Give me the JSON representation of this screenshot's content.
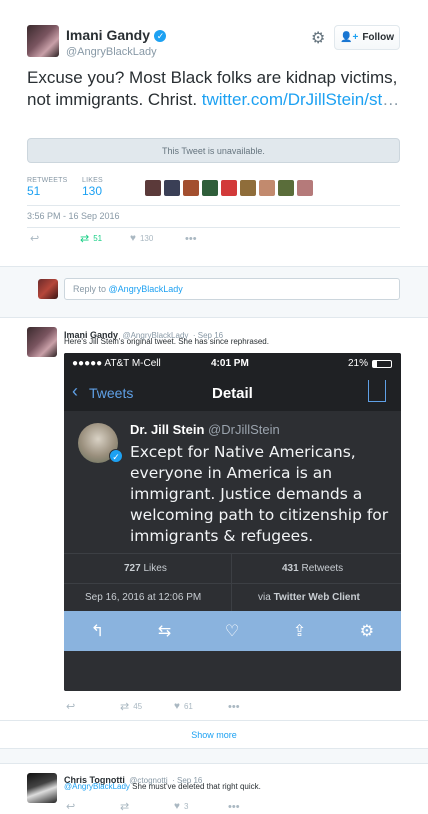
{
  "main_tweet": {
    "name": "Imani Gandy",
    "handle": "@AngryBlackLady",
    "follow_label": "Follow",
    "text": "Excuse you? Most Black folks are kidnap victims, not immigrants. Christ.",
    "link": "twitter.com/DrJillStein/st",
    "link_ellipsis": "…",
    "unavailable": "This Tweet is unavailable.",
    "retweets_label": "RETWEETS",
    "retweets": "51",
    "likes_label": "LIKES",
    "likes": "130",
    "timestamp": "3:56 PM - 16 Sep 2016",
    "retweet_count": "51",
    "like_count": "130",
    "liker_colors": [
      "#5b3a3a",
      "#3a3f56",
      "#a34f2f",
      "#2f5e3a",
      "#d23a3a",
      "#8f6d3a",
      "#c28a6e",
      "#5a6d3a",
      "#b57a7a"
    ]
  },
  "reply_box": {
    "prefix": "Reply to",
    "mention": "@AngryBlackLady"
  },
  "reply1": {
    "name": "Imani Gandy",
    "handle": "@AngryBlackLady",
    "date": "· Sep 16",
    "text": "Here's Jill Stein's original tweet. She has since rephrased.",
    "retweets": "45",
    "likes": "61"
  },
  "phone": {
    "carrier": "●●●●● AT&T M-Cell",
    "time": "4:01 PM",
    "battery": "21%",
    "back_label": "Tweets",
    "title": "Detail",
    "author_name": "Dr. Jill Stein",
    "author_handle": "@DrJillStein",
    "tweet": "Except for Native Americans, everyone in America is an immigrant. Justice demands a welcoming path to citizenship for immigrants & refugees.",
    "likes_num": "727",
    "likes_label": "Likes",
    "retweets_num": "431",
    "retweets_label": "Retweets",
    "date": "Sep 16, 2016 at 12:06 PM",
    "via": "via",
    "client": "Twitter Web Client"
  },
  "show_more": "Show more",
  "reply2": {
    "name": "Chris Tognotti",
    "handle": "@ctognotti",
    "date": "· Sep 16",
    "mention": "@AngryBlackLady",
    "text": " She must've deleted that right quick.",
    "likes": "3"
  }
}
